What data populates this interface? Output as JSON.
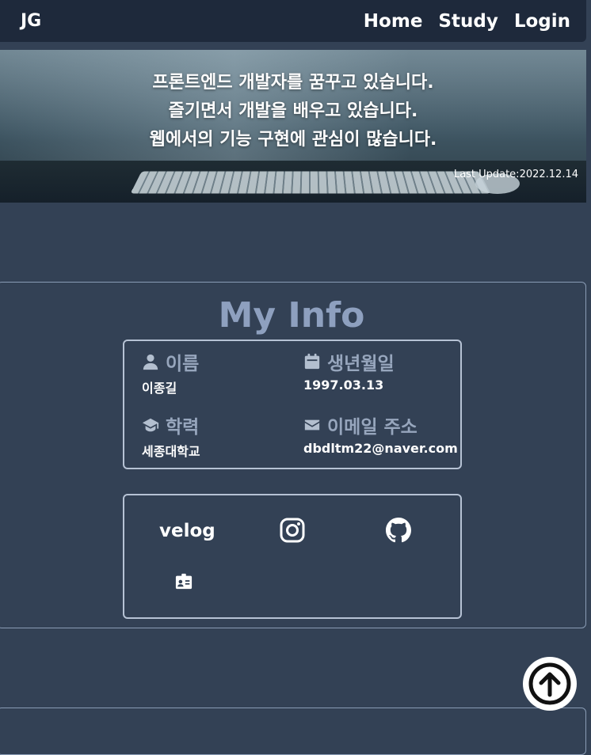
{
  "nav": {
    "logo": "JG",
    "links": [
      "Home",
      "Study",
      "Login"
    ]
  },
  "hero": {
    "lines": [
      "프론트엔드 개발자를 꿈꾸고 있습니다.",
      "즐기면서 개발을 배우고 있습니다.",
      "웹에서의 기능 구현에 관심이 많습니다."
    ],
    "last_update": "Last Update:2022.12.14"
  },
  "info": {
    "title": "My Info",
    "items": [
      {
        "icon": "person-icon",
        "label": "이름",
        "value": "이종길"
      },
      {
        "icon": "calendar-icon",
        "label": "생년월일",
        "value": "1997.03.13"
      },
      {
        "icon": "graduation-cap-icon",
        "label": "학력",
        "value": "세종대학교"
      },
      {
        "icon": "envelope-icon",
        "label": "이메일 주소",
        "value": "dbdltm22@naver.com"
      }
    ]
  },
  "links": {
    "velog": "velog",
    "icons": [
      "instagram-icon",
      "github-icon",
      "resume-card-icon"
    ]
  },
  "colors": {
    "background": "#334155",
    "navbar": "#1e293b",
    "title": "#8ea0bf"
  }
}
